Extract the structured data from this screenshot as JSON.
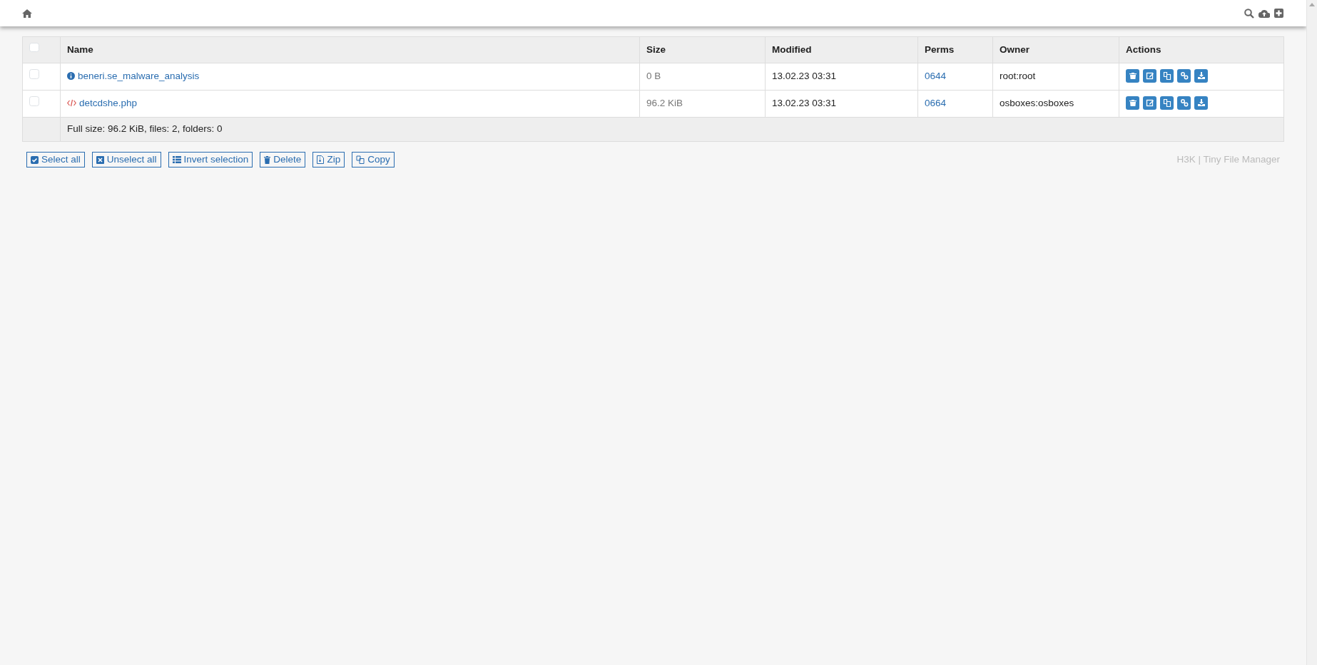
{
  "table": {
    "select_all": {
      "checked": false
    },
    "columns": [
      "Name",
      "Size",
      "Modified",
      "Perms",
      "Owner",
      "Actions"
    ],
    "rows": [
      {
        "checked": false,
        "kind": "info",
        "name": "beneri.se_malware_analysis",
        "size": "0 B",
        "modified": "13.02.23 03:31",
        "perms": "0644",
        "owner": "root:root"
      },
      {
        "checked": false,
        "kind": "code",
        "name": "detcdshe.php",
        "size": "96.2 KiB",
        "modified": "13.02.23 03:31",
        "perms": "0664",
        "owner": "osboxes:osboxes"
      }
    ],
    "summary": "Full size: 96.2 KiB, files: 2, folders: 0"
  },
  "buttons": [
    {
      "kind": "check",
      "label": "Select all"
    },
    {
      "kind": "cross",
      "label": "Unselect all"
    },
    {
      "kind": "list",
      "label": "Invert selection"
    },
    {
      "kind": "trash",
      "label": "Delete"
    },
    {
      "kind": "zip",
      "label": "Zip"
    },
    {
      "kind": "copy",
      "label": "Copy"
    }
  ],
  "footer": "H3K | Tiny File Manager"
}
